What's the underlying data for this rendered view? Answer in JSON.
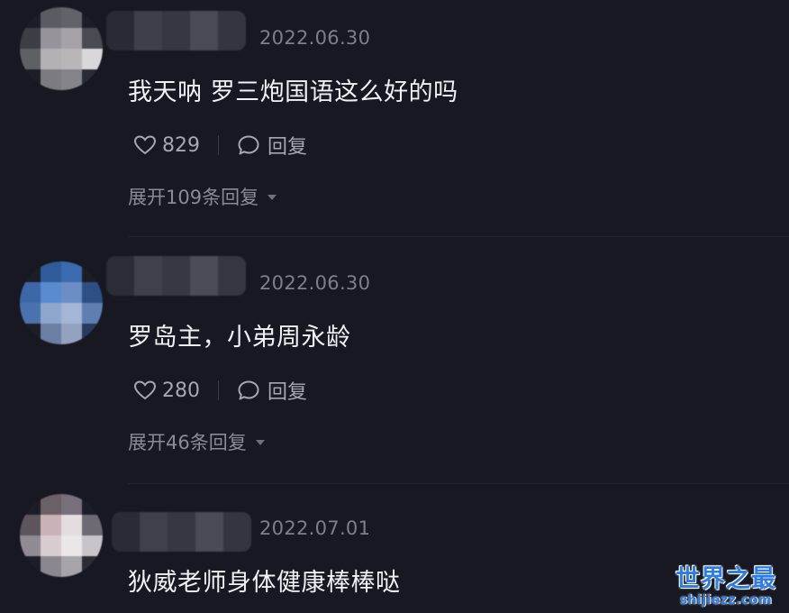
{
  "comments": [
    {
      "timestamp": "2022.06.30",
      "text": "我天呐 罗三炮国语这么好的吗",
      "likes": "829",
      "reply_label": "回复",
      "expand_label": "展开109条回复"
    },
    {
      "timestamp": "2022.06.30",
      "text": "罗岛主，小弟周永龄",
      "likes": "280",
      "reply_label": "回复",
      "expand_label": "展开46条回复"
    },
    {
      "timestamp": "2022.07.01",
      "text": "狄威老师身体健康棒棒哒"
    }
  ],
  "watermark": {
    "main": "世界之最",
    "sub": "shijiezz.com"
  },
  "colors": {
    "background": "#171821",
    "watermark": "#2f7de1"
  }
}
